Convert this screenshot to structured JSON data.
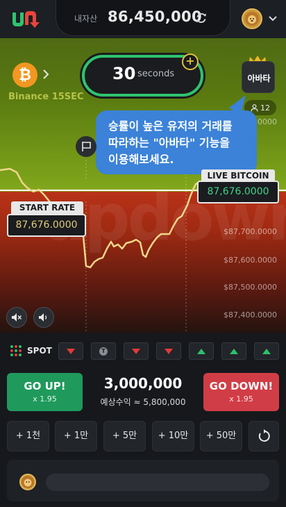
{
  "header": {
    "balance_label": "내자산",
    "balance_value": "86,450,000"
  },
  "market": {
    "name": "Binance 15SEC",
    "coin_symbol": "₿"
  },
  "timer": {
    "value": "30",
    "unit": "seconds"
  },
  "avatar_feature": {
    "label": "아바타",
    "followers": "12"
  },
  "tooltip": {
    "line1": "승률이 높은 유저의 거래를",
    "line2": "따라하는 \"아바타\" 기능을",
    "line3": "이용해보세요."
  },
  "chart": {
    "axis_labels": [
      "$87,800.0000",
      "$87,700.0000",
      "$87,600.0000",
      "$87,500.0000",
      "$87,400.0000"
    ],
    "start_rate_label": "START RATE",
    "start_rate_value": "87,676.0000",
    "live_label": "LIVE BITCOIN",
    "live_value": "87,676.0000",
    "watermark": "updown",
    "colors": {
      "up_zone": "#7ea51b",
      "down_zone": "#b83218",
      "price_line": "#f0d78a"
    }
  },
  "spot": {
    "label": "SPOT",
    "history": [
      "down",
      "tie",
      "down",
      "down",
      "up",
      "up",
      "up"
    ]
  },
  "bet": {
    "up_label": "GO UP!",
    "up_multiplier": "x 1.95",
    "down_label": "GO DOWN!",
    "down_multiplier": "x 1.95",
    "amount": "3,000,000",
    "expected_payout": "예상수익 ≈ 5,800,000",
    "colors": {
      "up": "#1f9a5c",
      "down": "#d13d46"
    }
  },
  "chips": [
    "+ 1천",
    "+ 1만",
    "+ 5만",
    "+ 10만",
    "+ 50만"
  ],
  "chat": {
    "placeholder": ""
  }
}
